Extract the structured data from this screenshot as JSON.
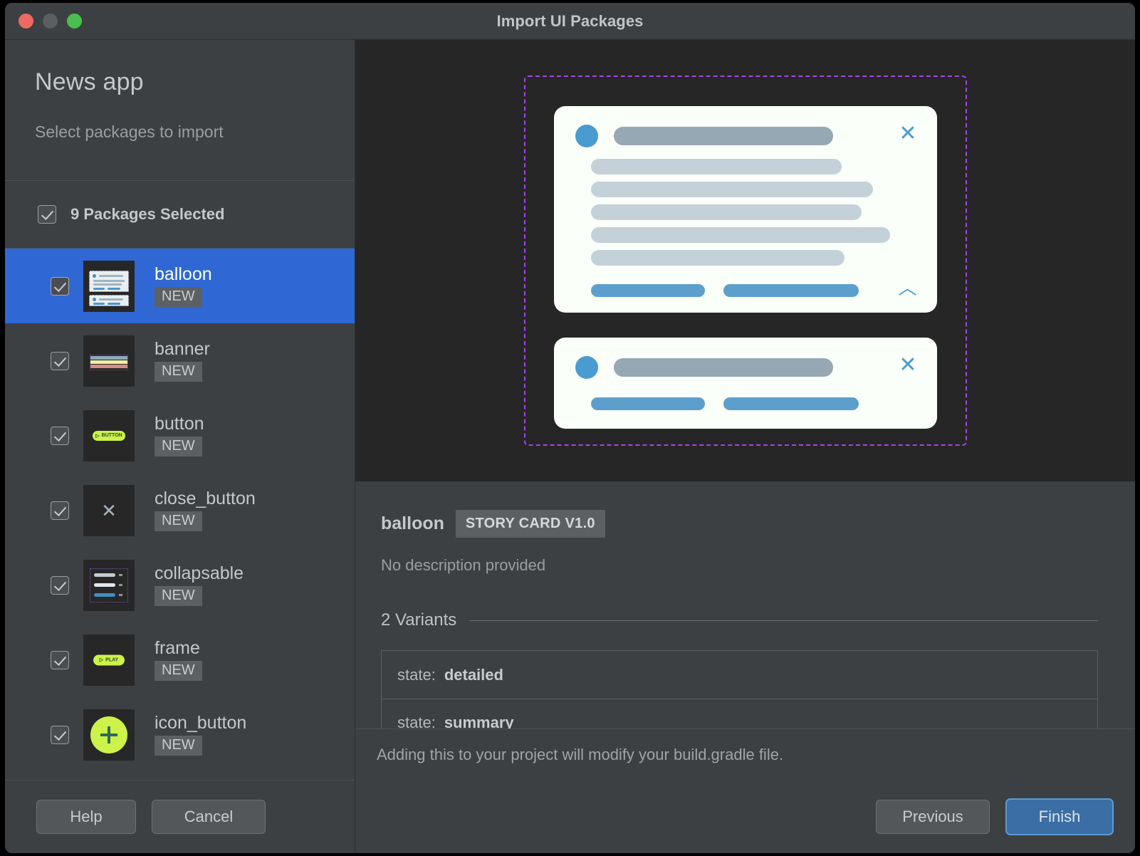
{
  "window": {
    "title": "Import UI Packages",
    "traffic_lights": [
      "close-button",
      "minimize-button",
      "maximize-button"
    ]
  },
  "sidebar": {
    "app_title": "News app",
    "subtitle": "Select packages to import",
    "selected_summary": "9 Packages Selected",
    "packages": [
      {
        "name": "balloon",
        "badge": "NEW",
        "checked": true,
        "selected": true,
        "thumb": "balloon-thumbnail"
      },
      {
        "name": "banner",
        "badge": "NEW",
        "checked": true,
        "selected": false,
        "thumb": "banner-thumbnail"
      },
      {
        "name": "button",
        "badge": "NEW",
        "checked": true,
        "selected": false,
        "thumb": "button-thumbnail"
      },
      {
        "name": "close_button",
        "badge": "NEW",
        "checked": true,
        "selected": false,
        "thumb": "close-button-thumbnail"
      },
      {
        "name": "collapsable",
        "badge": "NEW",
        "checked": true,
        "selected": false,
        "thumb": "collapsable-thumbnail"
      },
      {
        "name": "frame",
        "badge": "NEW",
        "checked": true,
        "selected": false,
        "thumb": "frame-thumbnail"
      },
      {
        "name": "icon_button",
        "badge": "NEW",
        "checked": true,
        "selected": false,
        "thumb": "icon-button-thumbnail"
      }
    ],
    "footer": {
      "help_label": "Help",
      "cancel_label": "Cancel"
    }
  },
  "preview": {
    "frame_border_color": "#a445e8",
    "card_background": "#fafffa",
    "accent_blue": "#4a9bd0",
    "cards": [
      {
        "name": "detailed-story-card",
        "close_icon": "×",
        "collapse_icon": "︿",
        "title_width": 308,
        "line_widths": [
          352,
          396,
          380,
          420,
          356
        ],
        "action_widths": [
          160,
          190
        ]
      },
      {
        "name": "summary-story-card",
        "close_icon": "×",
        "title_width": 308,
        "line_widths": [],
        "action_widths": [
          160,
          190
        ]
      }
    ]
  },
  "details": {
    "name": "balloon",
    "badge": "STORY CARD V1.0",
    "description": "No description provided",
    "variants_title": "2 Variants",
    "variants": [
      {
        "key": "state:",
        "value": "detailed"
      },
      {
        "key": "state:",
        "value": "summary"
      }
    ]
  },
  "footer": {
    "note": "Adding this to your project will modify your build.gradle file.",
    "previous_label": "Previous",
    "finish_label": "Finish"
  }
}
